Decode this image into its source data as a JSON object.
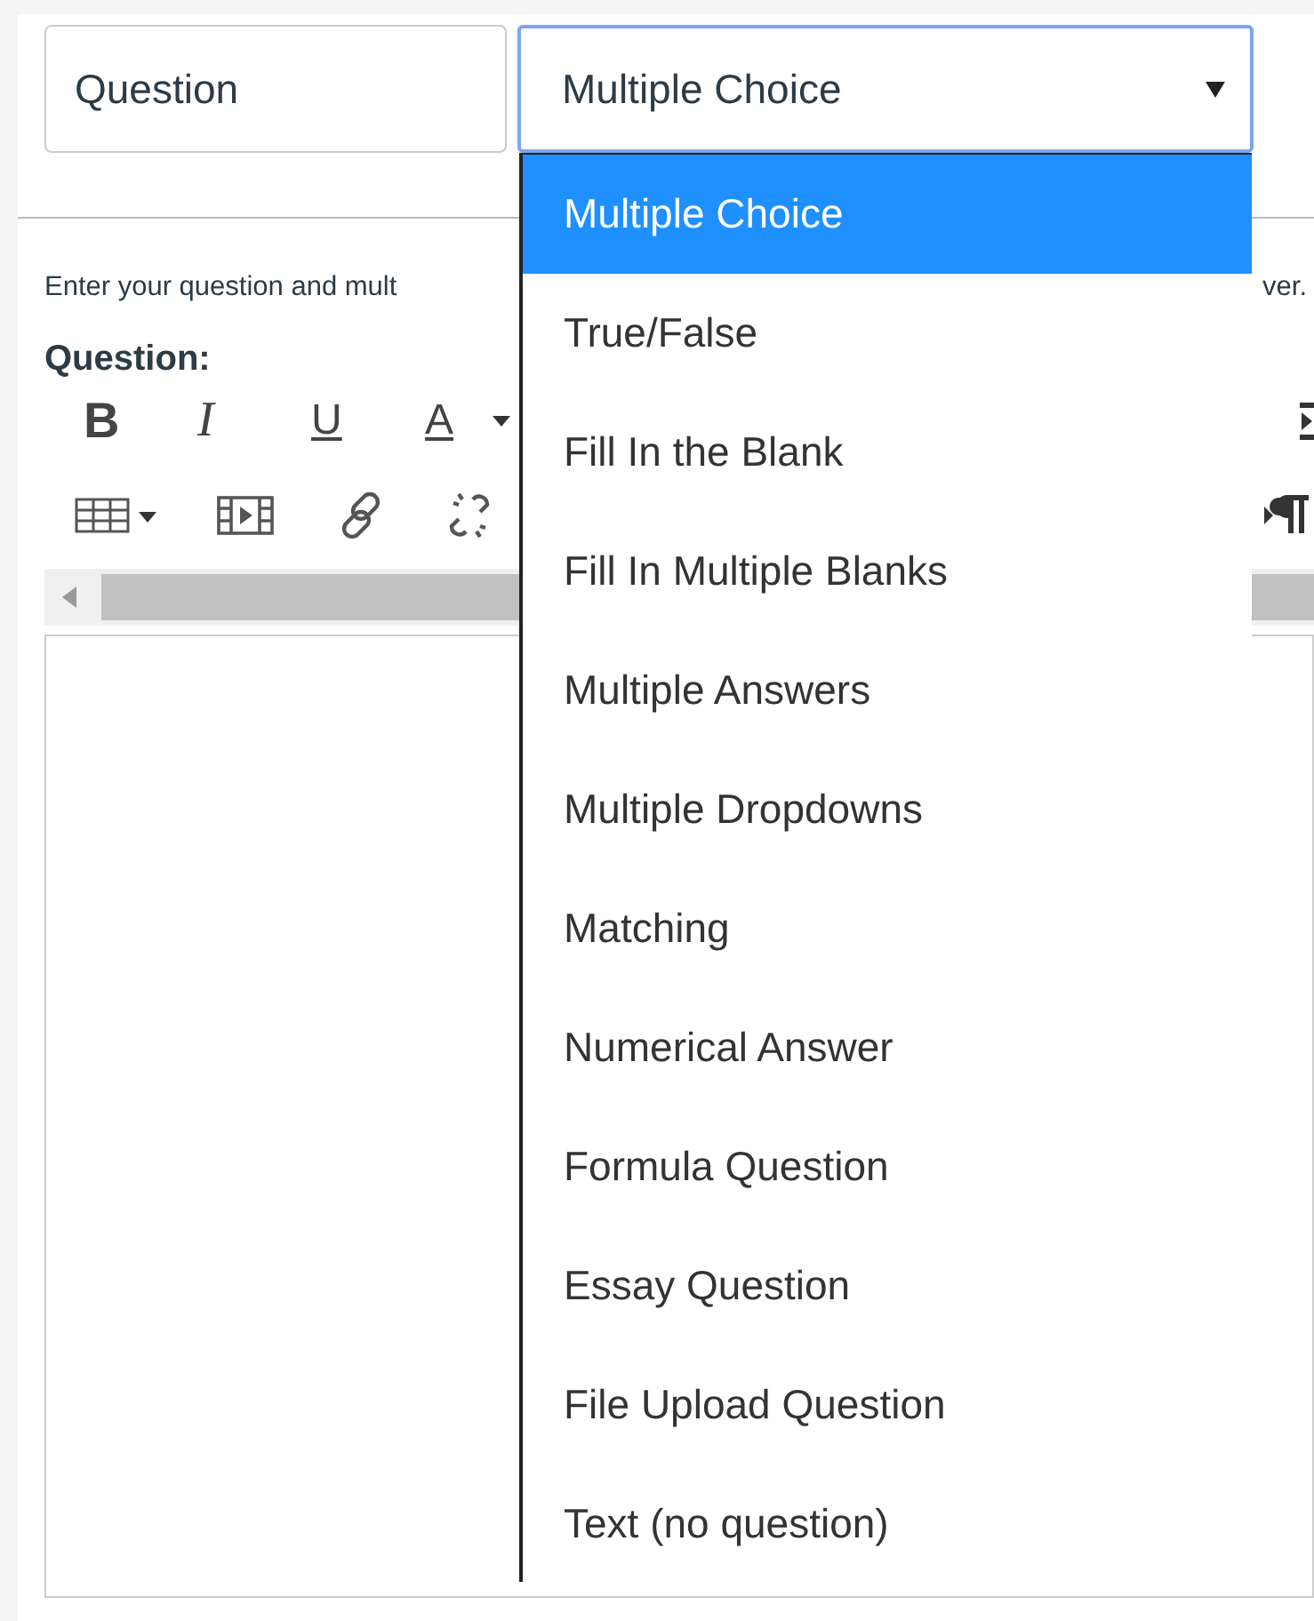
{
  "question_name": {
    "value": "Question"
  },
  "question_type": {
    "value": "Multiple Choice",
    "expanded": true,
    "options": [
      {
        "label": "Multiple Choice",
        "selected": true
      },
      {
        "label": "True/False",
        "selected": false
      },
      {
        "label": "Fill In the Blank",
        "selected": false
      },
      {
        "label": "Fill In Multiple Blanks",
        "selected": false
      },
      {
        "label": "Multiple Answers",
        "selected": false
      },
      {
        "label": "Multiple Dropdowns",
        "selected": false
      },
      {
        "label": "Matching",
        "selected": false
      },
      {
        "label": "Numerical Answer",
        "selected": false
      },
      {
        "label": "Formula Question",
        "selected": false
      },
      {
        "label": "Essay Question",
        "selected": false
      },
      {
        "label": "File Upload Question",
        "selected": false
      },
      {
        "label": "Text (no question)",
        "selected": false
      }
    ]
  },
  "instructions": {
    "visible_start": "Enter your question and mult",
    "visible_end": "ver."
  },
  "question_label": "Question:",
  "toolbar": {
    "format_buttons": [
      "B",
      "I",
      "U",
      "A"
    ]
  }
}
